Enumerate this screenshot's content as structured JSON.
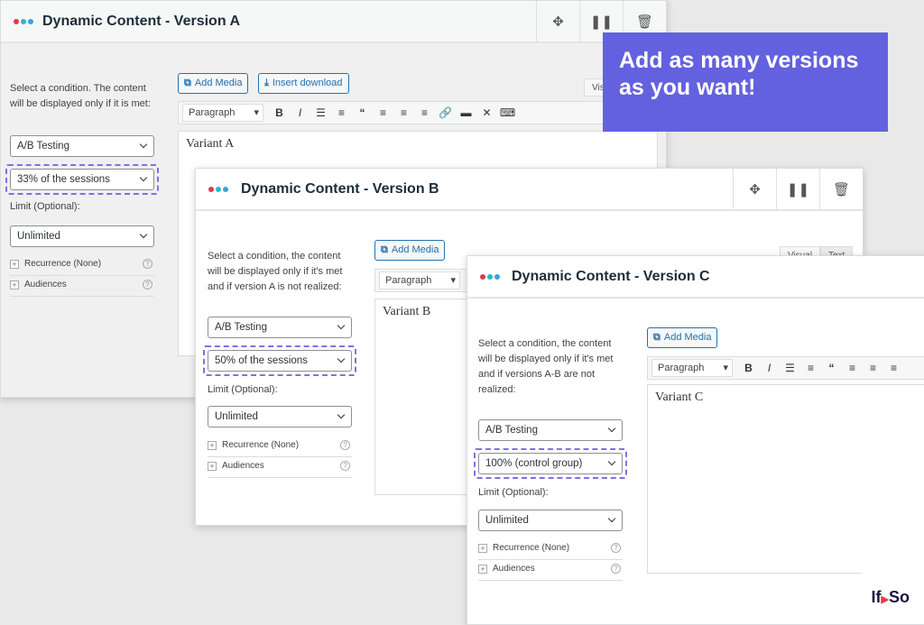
{
  "colors": {
    "accent": "#6461e0",
    "dot_red": "#e5374b",
    "dot_teal": "#2bb8c6",
    "dot_blue": "#36a4e0"
  },
  "banner": {
    "line1": "Add as many versions",
    "line2": "as you want!"
  },
  "logo": {
    "text_a": "If",
    "text_b": "So"
  },
  "editor": {
    "add_media": "Add Media",
    "insert_download": "Insert download",
    "paragraph": "Paragraph",
    "visual": "Visual",
    "text": "Text"
  },
  "common": {
    "ab_testing": "A/B Testing",
    "limit_label": "Limit (Optional):",
    "unlimited": "Unlimited",
    "recurrence": "Recurrence (None)",
    "audiences": "Audiences"
  },
  "panels": [
    {
      "title": "Dynamic Content - Version A",
      "instructions": "Select a condition. The content will be displayed only if it is met:",
      "sessions": "33% of the sessions",
      "content": "Variant A",
      "visual_tab": "Visu"
    },
    {
      "title": "Dynamic Content - Version B",
      "instructions": "Select a condition, the content will be displayed only if it's met and if version A is not realized:",
      "sessions": "50% of the sessions",
      "content": "Variant B"
    },
    {
      "title": "Dynamic Content - Version C",
      "instructions": "Select a condition, the content will be displayed only if it's met and if versions A-B are not realized:",
      "sessions": "100% (control group)",
      "content": "Variant C"
    }
  ]
}
